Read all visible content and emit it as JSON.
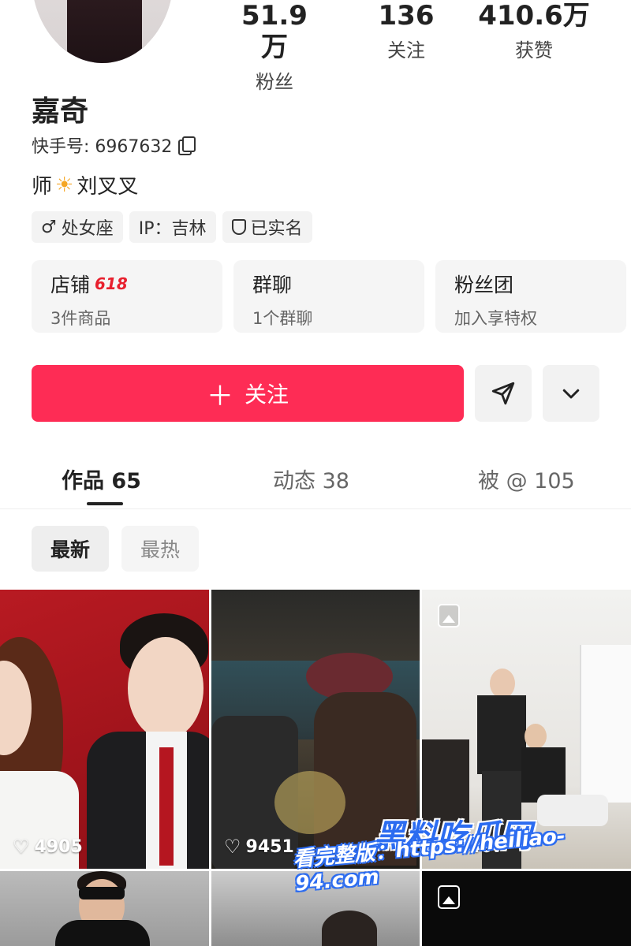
{
  "profile": {
    "name": "嘉奇",
    "kuaishou_id": "快手号: 6967632",
    "bio_prefix": "师",
    "bio_suffix": "刘叉叉",
    "stats": [
      {
        "value": "51.9万",
        "label": "粉丝"
      },
      {
        "value": "136",
        "label": "关注"
      },
      {
        "value": "410.6万",
        "label": "获赞"
      }
    ],
    "tags": [
      "处女座",
      "IP：吉林",
      "已实名"
    ]
  },
  "cards": [
    {
      "title": "店铺",
      "badge": "618",
      "sub": "3件商品"
    },
    {
      "title": "群聊",
      "sub": "1个群聊"
    },
    {
      "title": "粉丝团",
      "sub": "加入享特权"
    }
  ],
  "actions": {
    "follow_label": "关注"
  },
  "tabs": [
    {
      "label": "作品 65"
    },
    {
      "label": "动态 38"
    },
    {
      "label": "被 @ 105"
    }
  ],
  "sorts": [
    "最新",
    "最热"
  ],
  "grid": [
    {
      "likes": "4905"
    },
    {
      "likes": "9451"
    },
    {
      "likes": "4407"
    }
  ],
  "watermark": {
    "line1": "黑料吃瓜网",
    "line2": "看完整版：https://heiliao-94.com"
  },
  "colors": {
    "accent": "#fe2c55",
    "badge_red": "#e8202e",
    "watermark_blue": "#2c6cf0"
  }
}
